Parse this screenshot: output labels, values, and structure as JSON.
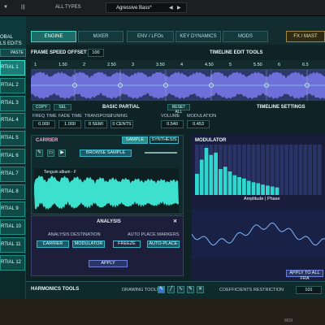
{
  "topbar": {
    "left_glyphs": [
      "▼",
      "|||"
    ],
    "type_filter": "ALL TYPES",
    "preset_name": "Agressive Bass*",
    "arrows": [
      "◀",
      "▶"
    ]
  },
  "left": {
    "header_lines": [
      "OBAL",
      "LS EDITS"
    ],
    "paste_label": "PASTE",
    "partials": [
      {
        "label": "RTIAL 1"
      },
      {
        "label": "RTIAL 2"
      },
      {
        "label": "RTIAL 3"
      },
      {
        "label": "RTIAL 4"
      },
      {
        "label": "RTIAL 5"
      },
      {
        "label": "RTIAL 6"
      },
      {
        "label": "RTIAL 7"
      },
      {
        "label": "RTIAL 8"
      },
      {
        "label": "RTIAL 9"
      },
      {
        "label": "RTIAL 10"
      },
      {
        "label": "RTIAL 11"
      },
      {
        "label": "RTIAL 12"
      }
    ]
  },
  "tabs": {
    "engine": "ENGINE",
    "mixer": "MIXER",
    "env_lfos": "ENV / LFOs",
    "key_dynamics": "KEY DYNAMICS",
    "mods": "MODS",
    "fx_master": "FX / MAST"
  },
  "timeline": {
    "frame_speed_label": "FRAME SPEED OFFSET",
    "frame_speed_value": "100",
    "edit_tools_label": "TIMELINE EDIT TOOLS",
    "ruler_ticks": [
      "1",
      "1.50",
      "2",
      "2.50",
      "3",
      "3.50",
      "4",
      "4.50",
      "5",
      "5.50",
      "6",
      "6.5"
    ],
    "copy": "COPY",
    "sel": "SEL",
    "basic_partial": "BASIC PARTIAL",
    "reset_all": "RESET ALL",
    "settings": "TIMELINE SETTINGS"
  },
  "params": {
    "labels": [
      "FREQ TIME",
      "FADE TIME",
      "TRANSPOSE",
      "TUNING",
      "VOLUME",
      "MODULATION"
    ],
    "values": [
      "0.000",
      "1.000",
      "0 SEMI",
      "0 CENTS",
      "0.540",
      "0.453"
    ]
  },
  "carrier": {
    "title": "CARRIER",
    "sample_tab": "SAMPLE",
    "synthesis_tab": "SYNTHESIS",
    "browse": "BROWSE SAMPLE",
    "sample_name": "Tenguin album - F"
  },
  "analysis": {
    "title": "ANALYSIS",
    "close": "✕",
    "dest_label": "ANALYSIS DESTINATION",
    "carrier_btn": "CARRIER",
    "modulator_btn": "MODULATOR",
    "auto_place_label": "AUTO PLACE MARKERS",
    "freeze": "FREEZE",
    "auto_place_btn": "AUTO-PLACE",
    "apply": "APPLY"
  },
  "modulator": {
    "title": "MODULATOR",
    "amp_label": "Amplitude | Phase",
    "apply_all": "APPLY TO ALL FRA"
  },
  "harmonics": {
    "title": "HARMONICS TOOLS",
    "drawing_tools": "DRAWING TOOLS",
    "coeff": "COEFFICIENTS RESTRICTION",
    "value": "101"
  },
  "bottom": {
    "right_text": "MIDI"
  },
  "colors": {
    "accent": "#3de0cc",
    "wave_purple": "#6f6fd9",
    "mod_bar": "#2fd7cf"
  }
}
